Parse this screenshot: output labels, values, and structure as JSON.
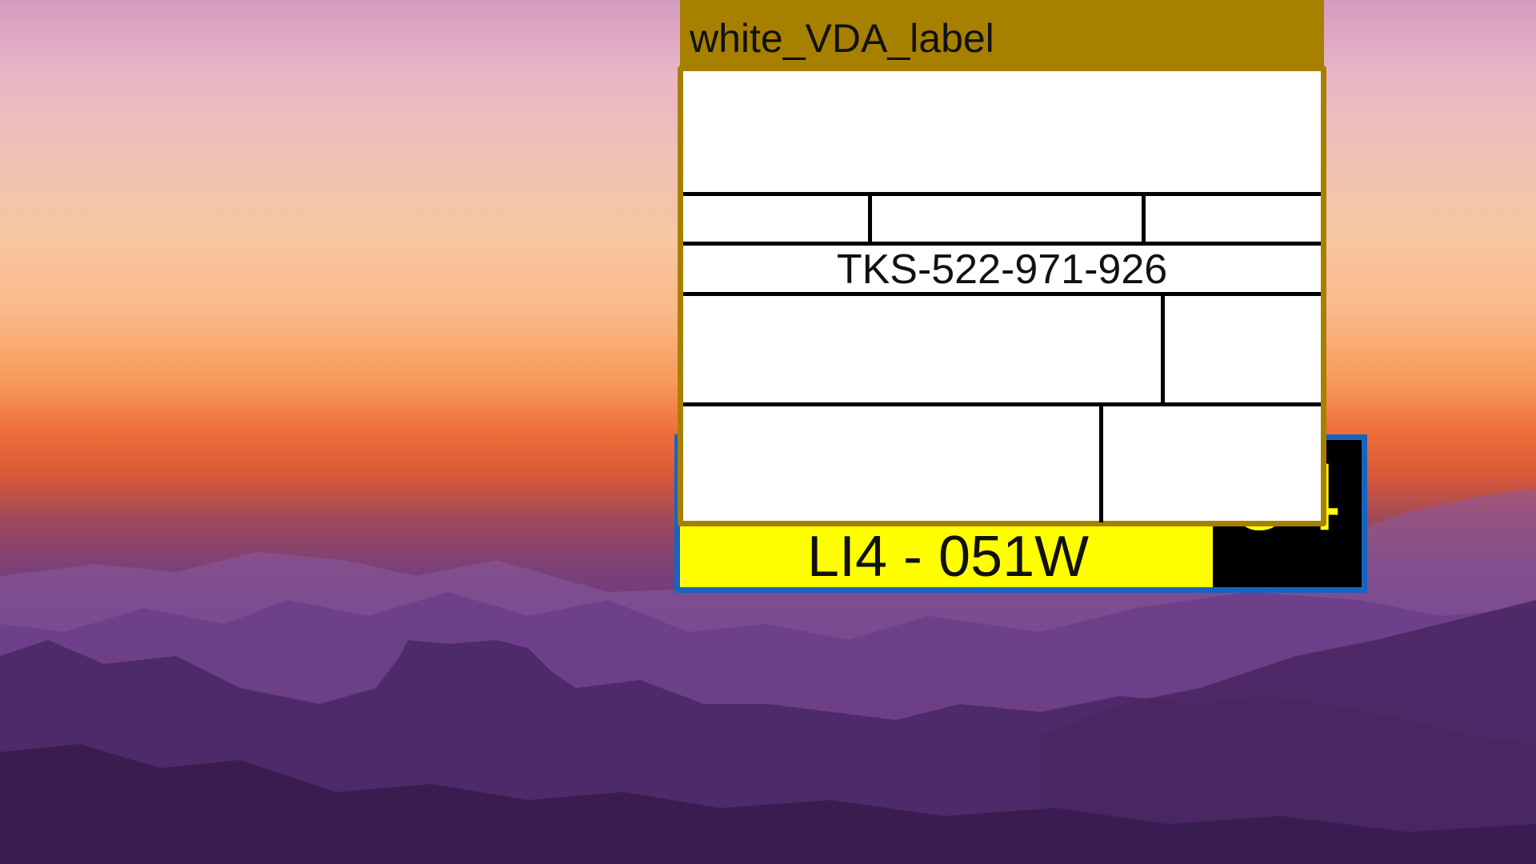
{
  "background": {
    "name": "sunset-mountain-wallpaper"
  },
  "plate_label": {
    "text": "LI4 - 051W",
    "number": "54",
    "colors": {
      "background": "#ffff00",
      "border": "#1565c0",
      "number_box": "#000000",
      "number_text": "#ffff00"
    }
  },
  "vda_label": {
    "title": "white_VDA_label",
    "code": "TKS-522-971-926",
    "colors": {
      "frame": "#a88000",
      "body": "#ffffff"
    }
  }
}
